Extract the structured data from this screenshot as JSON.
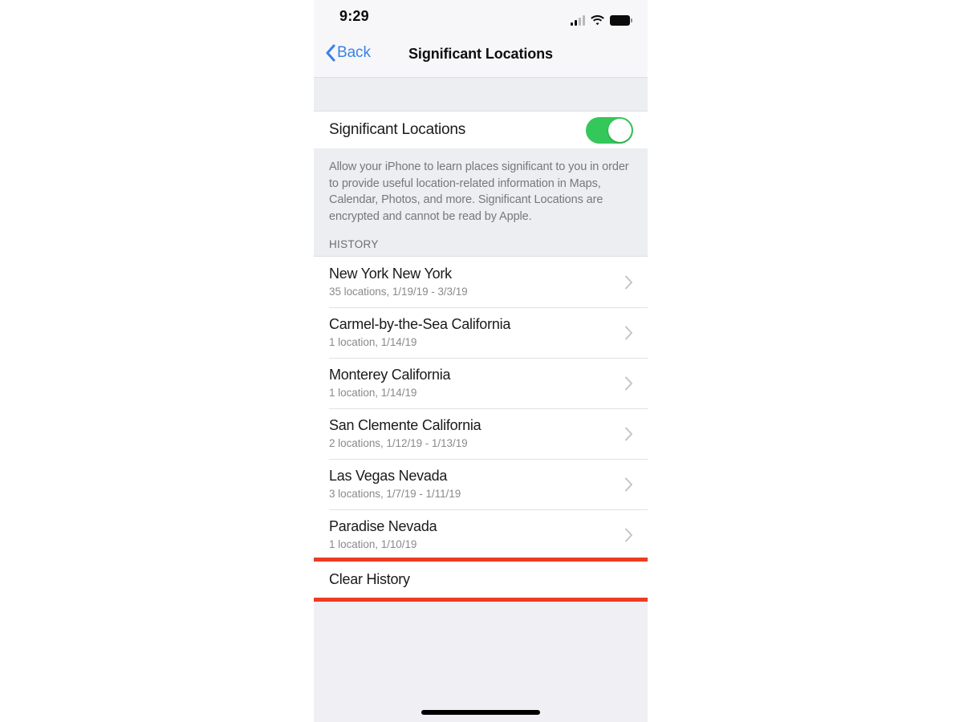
{
  "status_bar": {
    "time": "9:29",
    "icons": [
      "cellular-signal-icon",
      "wifi-icon",
      "battery-icon"
    ]
  },
  "nav_bar": {
    "back_label": "Back",
    "back_icon": "chevron-left-icon",
    "title": "Significant Locations"
  },
  "toggle_section": {
    "label": "Significant Locations",
    "enabled": true,
    "accent_color": "#34C759"
  },
  "footer_note": "Allow your iPhone to learn places significant to you in order to provide useful location-related information in Maps, Calendar, Photos, and more. Significant Locations are encrypted and cannot be read by Apple.",
  "history": {
    "section_header": "HISTORY",
    "items": [
      {
        "title": "New York New York",
        "subtitle": "35 locations, 1/19/19 - 3/3/19"
      },
      {
        "title": "Carmel-by-the-Sea California",
        "subtitle": "1 location, 1/14/19"
      },
      {
        "title": "Monterey California",
        "subtitle": "1 location, 1/14/19"
      },
      {
        "title": "San Clemente California",
        "subtitle": "2 locations, 1/12/19 - 1/13/19"
      },
      {
        "title": "Las Vegas Nevada",
        "subtitle": "3 locations, 1/7/19 - 1/11/19"
      },
      {
        "title": "Paradise Nevada",
        "subtitle": "1 location, 1/10/19"
      }
    ]
  },
  "clear_history": {
    "label": "Clear History",
    "highlight_color": "#EE3B22",
    "highlighted": true
  },
  "home_indicator": "home-indicator"
}
